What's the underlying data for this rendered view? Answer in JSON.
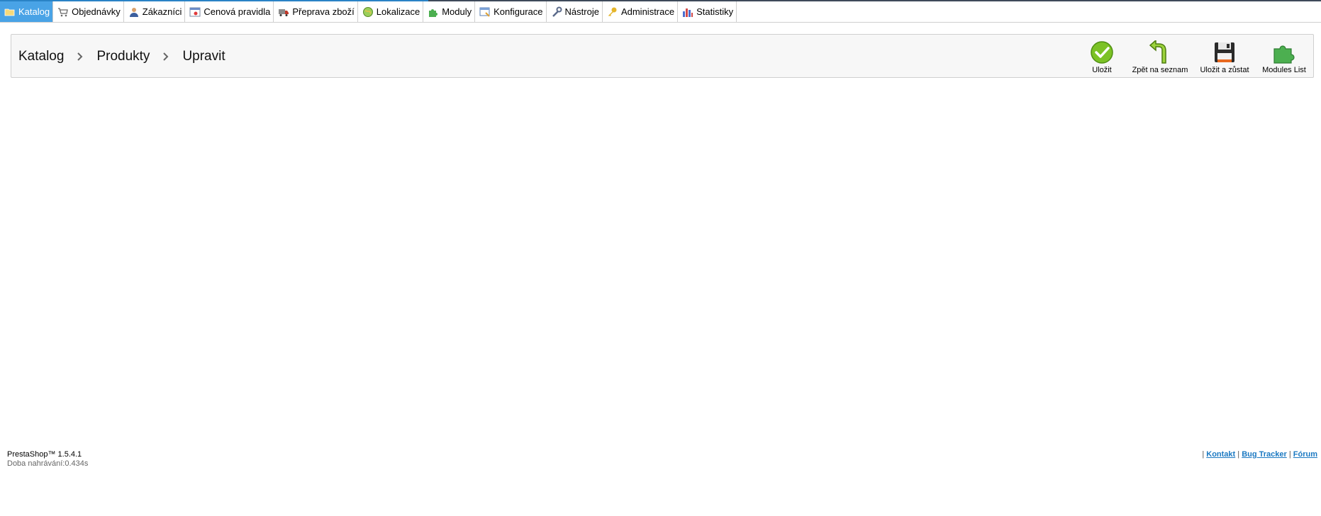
{
  "menu": {
    "items": [
      {
        "label": "Katalog",
        "icon": "folder-icon"
      },
      {
        "label": "Objednávky",
        "icon": "cart-icon"
      },
      {
        "label": "Zákazníci",
        "icon": "user-icon"
      },
      {
        "label": "Cenová pravidla",
        "icon": "price-rules-icon"
      },
      {
        "label": "Přeprava zboží",
        "icon": "truck-icon"
      },
      {
        "label": "Lokalizace",
        "icon": "globe-icon"
      },
      {
        "label": "Moduly",
        "icon": "puzzle-icon"
      },
      {
        "label": "Konfigurace",
        "icon": "config-icon"
      },
      {
        "label": "Nástroje",
        "icon": "wrench-icon"
      },
      {
        "label": "Administrace",
        "icon": "key-icon"
      },
      {
        "label": "Statistiky",
        "icon": "bar-chart-icon"
      }
    ],
    "active_index": 0
  },
  "breadcrumb": {
    "items": [
      "Katalog",
      "Produkty",
      "Upravit"
    ]
  },
  "toolbar": {
    "save_label": "Uložit",
    "back_label": "Zpět na seznam",
    "save_stay_label": "Uložit a zůstat",
    "modules_list_label": "Modules List"
  },
  "footer": {
    "version": "PrestaShop™ 1.5.4.1",
    "load_time": "Doba nahrávání:0.434s",
    "separator": "|",
    "contact": "Kontakt",
    "bug_tracker": "Bug Tracker",
    "forum": "Fórum"
  },
  "colors": {
    "active_tab": "#49a3e6",
    "link": "#1b79c2",
    "toolbar_bg": "#f7f7f7"
  }
}
